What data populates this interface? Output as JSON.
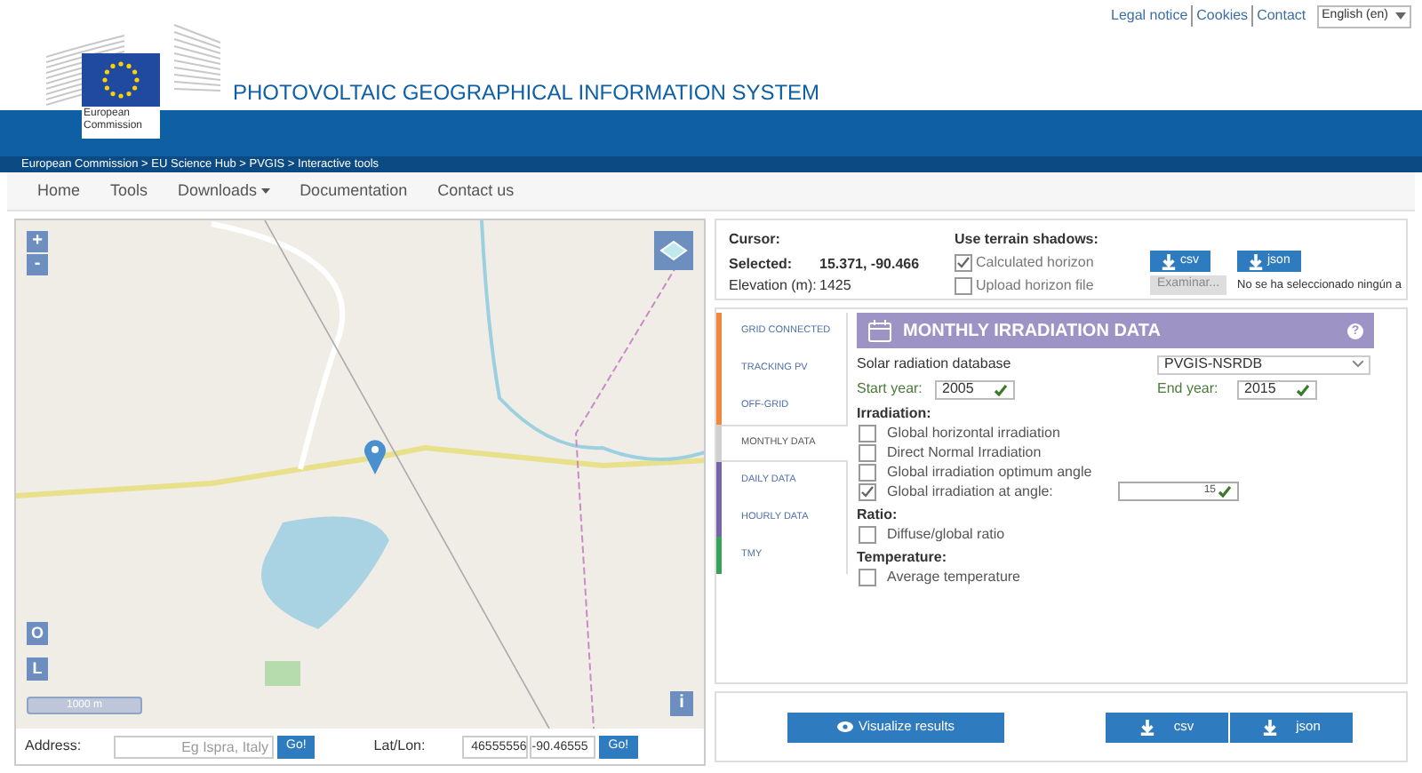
{
  "top_links": [
    "Legal notice",
    "Cookies",
    "Contact"
  ],
  "language": "English (en)",
  "logo_text": "European Commission",
  "site_title": "PHOTOVOLTAIC GEOGRAPHICAL INFORMATION SYSTEM",
  "breadcrumb": "European Commission > EU Science Hub > PVGIS > Interactive tools",
  "nav": [
    {
      "label": "Home",
      "dropdown": false
    },
    {
      "label": "Tools",
      "dropdown": false
    },
    {
      "label": "Downloads",
      "dropdown": true
    },
    {
      "label": "Documentation",
      "dropdown": false
    },
    {
      "label": "Contact us",
      "dropdown": false
    }
  ],
  "map": {
    "zoom_in": "+",
    "zoom_out": "-",
    "buttons": [
      "O",
      "L"
    ],
    "scale": "1000 m",
    "info": "i"
  },
  "address_bar": {
    "address_label": "Address:",
    "address_placeholder": "Eg Ispra, Italy",
    "go": "Go!",
    "latlon_label": "Lat/Lon:",
    "lat": "46555556",
    "lon": "-90.46555",
    "go2": "Go!"
  },
  "info": {
    "cursor_label": "Cursor:",
    "selected_label": "Selected:",
    "selected_value": "15.371, -90.466",
    "elevation_label": "Elevation (m):",
    "elevation_value": "1425",
    "shadows_label": "Use terrain shadows:",
    "options": [
      {
        "label": "Calculated horizon",
        "checked": true
      },
      {
        "label": "Upload horizon file",
        "checked": false
      }
    ],
    "downloads": [
      "csv",
      "json"
    ],
    "browse": "Examinar...",
    "file_status": "No se ha seleccionado ningún a"
  },
  "tabs": [
    {
      "label": "GRID CONNECTED",
      "color": "#f0873a",
      "selected": false
    },
    {
      "label": "TRACKING PV",
      "color": "#f0873a",
      "selected": false
    },
    {
      "label": "OFF-GRID",
      "color": "#f0873a",
      "selected": false
    },
    {
      "label": "MONTHLY DATA",
      "color": "#d0d0d0",
      "selected": true
    },
    {
      "label": "DAILY DATA",
      "color": "#7663a8",
      "selected": false
    },
    {
      "label": "HOURLY DATA",
      "color": "#7663a8",
      "selected": false
    },
    {
      "label": "TMY",
      "color": "#3aa35b",
      "selected": false
    }
  ],
  "panel": {
    "title": "MONTHLY IRRADIATION DATA",
    "help": "?",
    "database_label": "Solar radiation database",
    "database_value": "PVGIS-NSRDB",
    "start_label": "Start year:",
    "start_value": "2005",
    "end_label": "End year:",
    "end_value": "2015",
    "sections": [
      {
        "heading": "Irradiation:",
        "items": [
          {
            "label": "Global horizontal irradiation",
            "checked": false
          },
          {
            "label": "Direct Normal Irradiation",
            "checked": false
          },
          {
            "label": "Global irradiation optimum angle",
            "checked": false
          },
          {
            "label": "Global irradiation at angle:",
            "checked": true,
            "value": "15"
          }
        ]
      },
      {
        "heading": "Ratio:",
        "items": [
          {
            "label": "Diffuse/global ratio",
            "checked": false
          }
        ]
      },
      {
        "heading": "Temperature:",
        "items": [
          {
            "label": "Average temperature",
            "checked": false
          }
        ]
      }
    ]
  },
  "bottom": {
    "visualize": "Visualize results",
    "downloads": [
      "csv",
      "json"
    ]
  }
}
